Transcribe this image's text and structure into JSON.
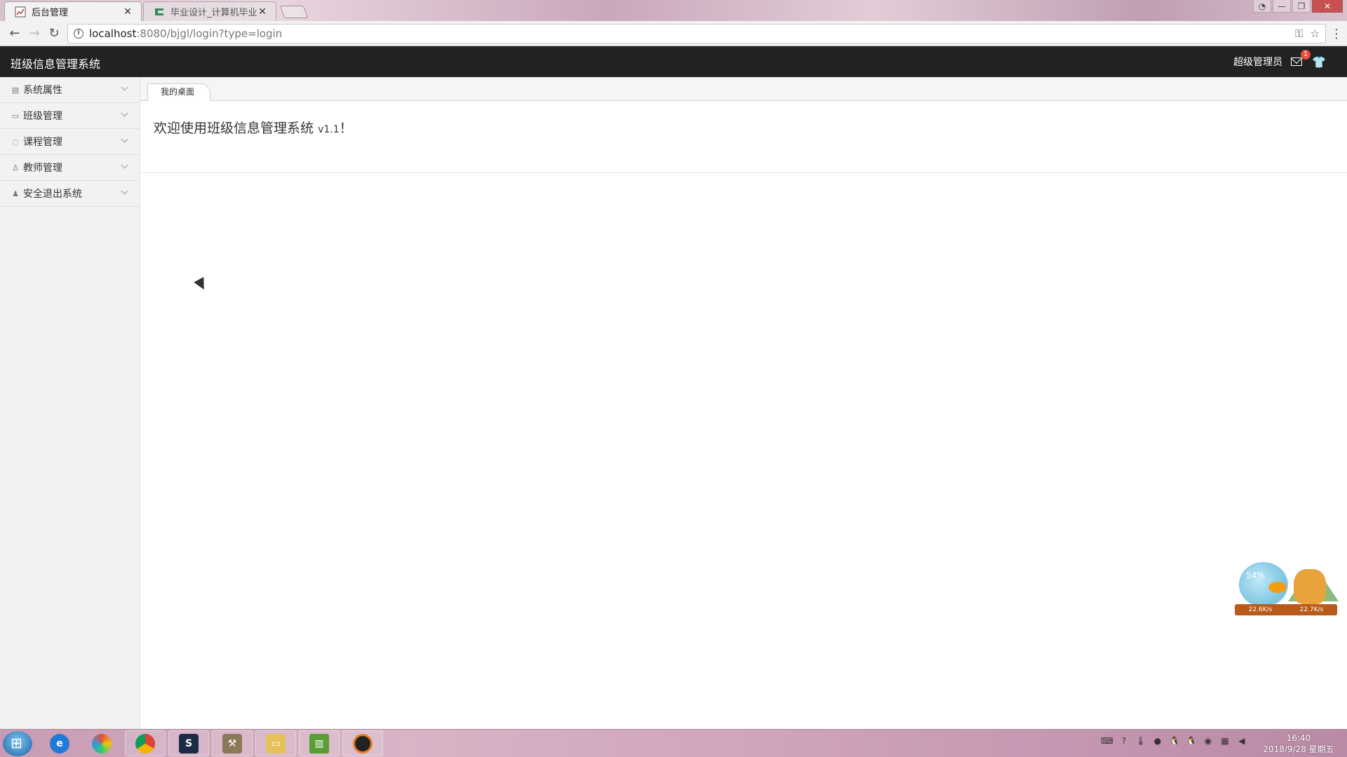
{
  "browser": {
    "tabs": [
      {
        "title": "后台管理",
        "active": true
      },
      {
        "title": "毕业设计_计算机毕业设计",
        "active": false
      }
    ],
    "url_host": "localhost",
    "url_path": ":8080/bjgl/login?type=login"
  },
  "header": {
    "app_title": "班级信息管理系统",
    "user_label": "超级管理员",
    "mail_badge": "1"
  },
  "sidebar": {
    "items": [
      {
        "label": "系统属性",
        "icon": "grid-icon"
      },
      {
        "label": "班级管理",
        "icon": "card-icon"
      },
      {
        "label": "课程管理",
        "icon": "chat-icon"
      },
      {
        "label": "教师管理",
        "icon": "user-outline-icon"
      },
      {
        "label": "安全退出系统",
        "icon": "user-icon"
      }
    ]
  },
  "main": {
    "tab_label": "我的桌面",
    "welcome_text": "欢迎使用班级信息管理系统",
    "version": "v1.1",
    "exclaim": "！"
  },
  "widget": {
    "percent": "54%",
    "upload": "22.6K/s",
    "download": "22.7K/s"
  },
  "taskbar": {
    "time": "16:40",
    "date": "2018/9/28 星期五"
  }
}
